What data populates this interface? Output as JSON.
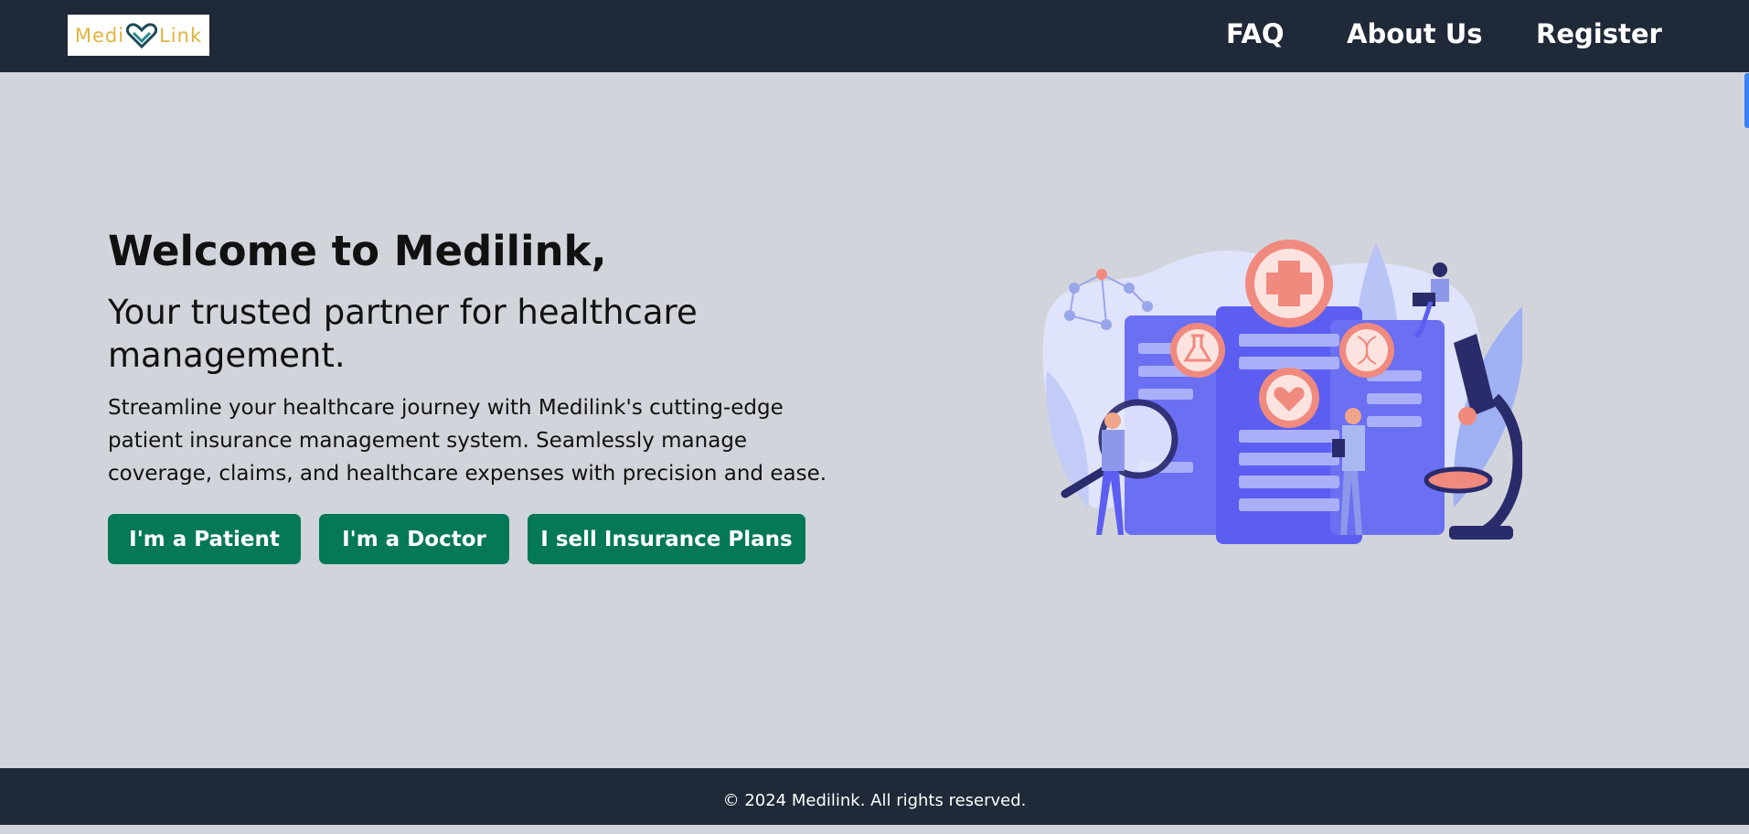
{
  "nav": {
    "logo_left": "Medi",
    "logo_right": "Link",
    "links": [
      "FAQ",
      "About Us",
      "Register"
    ]
  },
  "hero": {
    "title": "Welcome to Medilink,",
    "subtitle": "Your trusted partner for healthcare management.",
    "description": "Streamline your healthcare journey with Medilink's cutting-edge patient insurance management system. Seamlessly manage coverage, claims, and healthcare expenses with precision and ease.",
    "buttons": {
      "patient": "I'm a Patient",
      "doctor": "I'm a Doctor",
      "insurance": "I sell Insurance Plans"
    }
  },
  "footer": {
    "copyright": "© 2024 Medilink. All rights reserved."
  },
  "colors": {
    "nav_bg": "#1f2937",
    "page_bg": "#d1d5db",
    "button_bg": "#047857",
    "logo_text": "#e0b43c",
    "illustration_accent": "#5b5ef0"
  }
}
